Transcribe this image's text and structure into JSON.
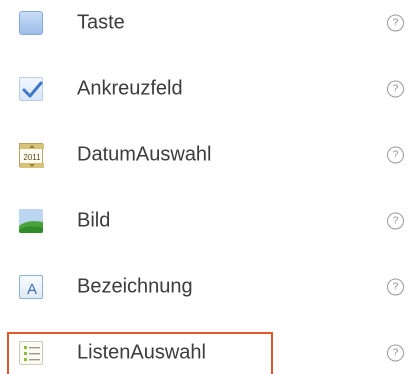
{
  "components": [
    {
      "id": "button",
      "label": "Taste",
      "icon": "button-icon",
      "help": "?"
    },
    {
      "id": "checkbox",
      "label": "Ankreuzfeld",
      "icon": "checkbox-icon",
      "help": "?"
    },
    {
      "id": "datepicker",
      "label": "DatumAuswahl",
      "icon": "calendar-icon",
      "icon_text": "2011",
      "help": "?"
    },
    {
      "id": "image",
      "label": "Bild",
      "icon": "image-icon",
      "help": "?"
    },
    {
      "id": "label",
      "label": "Bezeichnung",
      "icon": "label-icon",
      "icon_text": "A",
      "help": "?"
    },
    {
      "id": "listpicker",
      "label": "ListenAuswahl",
      "icon": "list-icon",
      "help": "?",
      "selected": true
    }
  ],
  "colors": {
    "selection_border": "#e2572b",
    "text": "#3c3c3c",
    "help": "#8a8a8a"
  }
}
